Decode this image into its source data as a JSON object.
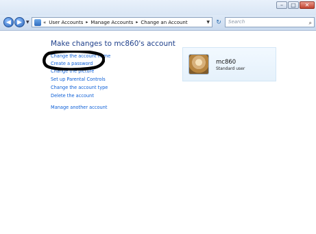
{
  "window": {
    "minimize": "–",
    "maximize": "□",
    "close": "✕"
  },
  "nav": {
    "back": "◀",
    "forward": "▶",
    "dropdown": "▼",
    "breadcrumb": [
      "User Accounts",
      "Manage Accounts",
      "Change an Account"
    ],
    "breadcrumb_prefix": "«",
    "separator": "▸",
    "address_dropdown": "▼",
    "refresh": "↻",
    "search_placeholder": "Search",
    "search_icon": "⌕"
  },
  "main": {
    "title": "Make changes to mc860's account",
    "links": [
      "Change the account name",
      "Create a password",
      "Change the picture",
      "Set up Parental Controls",
      "Change the account type",
      "Delete the account",
      "Manage another account"
    ]
  },
  "account": {
    "name": "mc860",
    "type": "Standard user"
  },
  "colors": {
    "link": "#0b5ed7",
    "title": "#1e3f8a",
    "annotation": "#000000"
  }
}
